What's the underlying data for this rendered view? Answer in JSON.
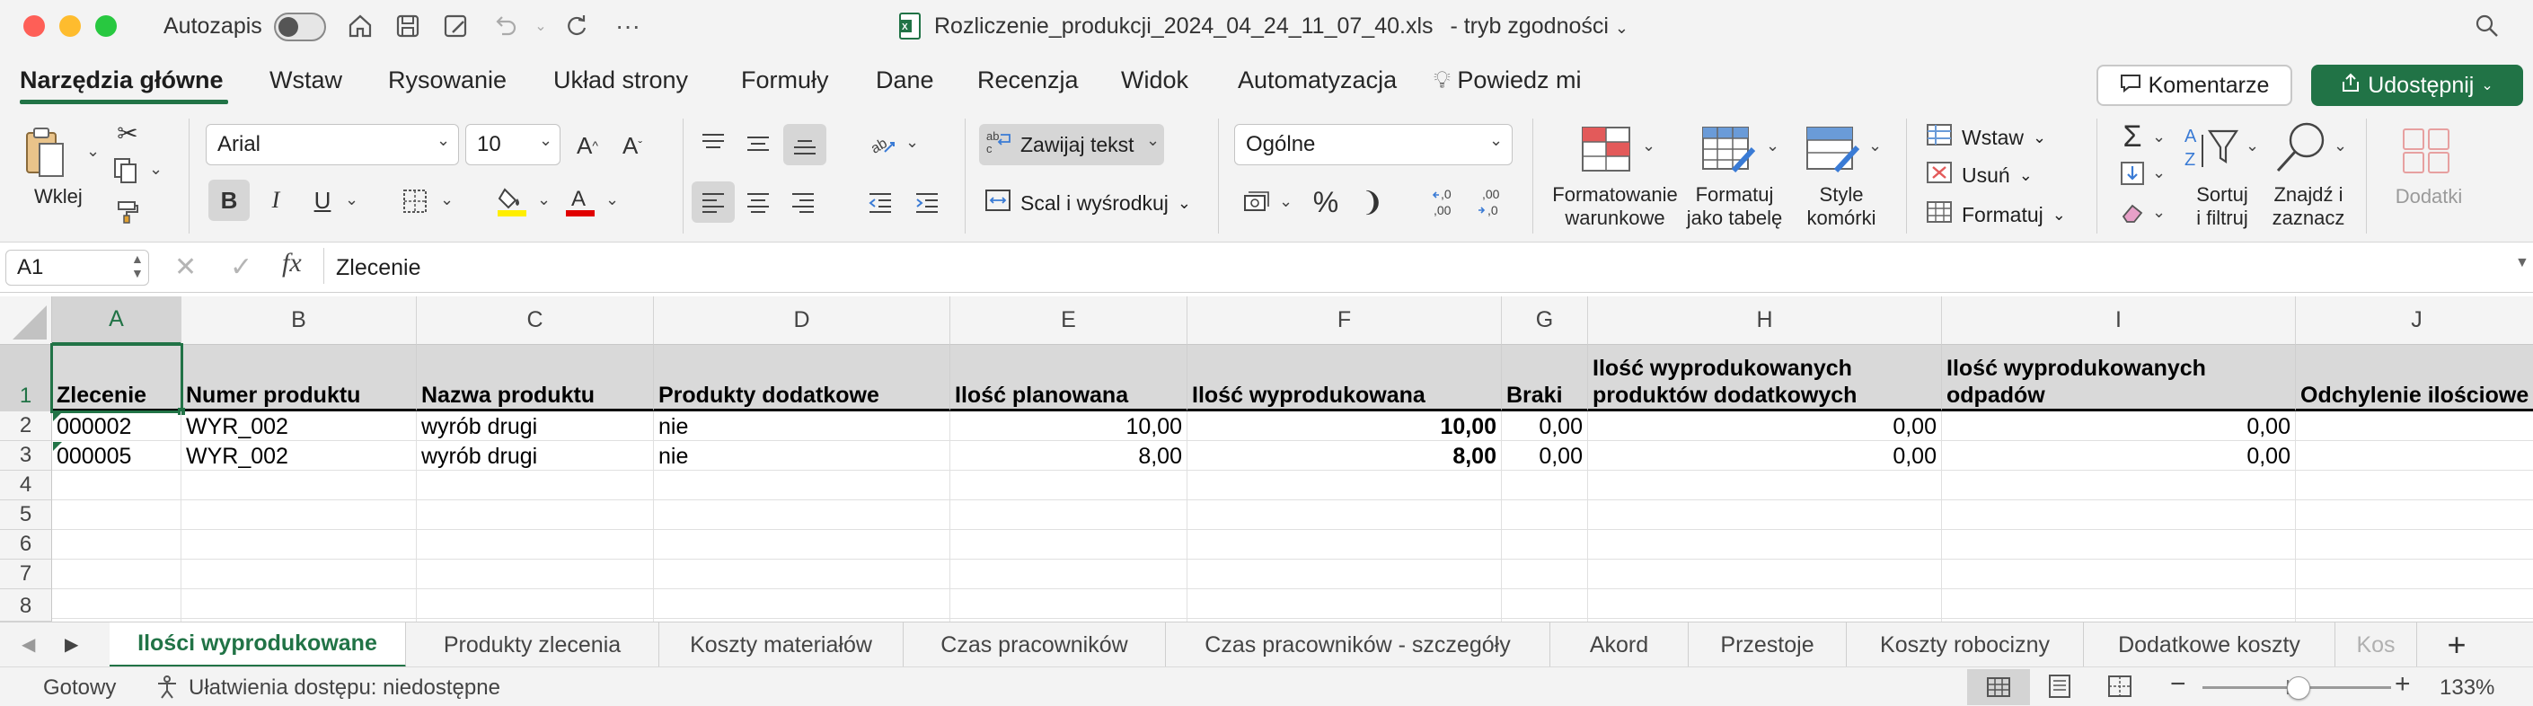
{
  "titlebar": {
    "autosave_label": "Autozapis",
    "filename": "Rozliczenie_produkcji_2024_04_24_11_07_40.xls",
    "mode": "-  tryb zgodności"
  },
  "ribbon_tabs": [
    "Narzędzia główne",
    "Wstaw",
    "Rysowanie",
    "Układ strony",
    "Formuły",
    "Dane",
    "Recenzja",
    "Widok",
    "Automatyzacja"
  ],
  "tell_me": "Powiedz mi",
  "comments_label": "Komentarze",
  "share_label": "Udostępnij",
  "ribbon": {
    "paste_label": "Wklej",
    "font_name": "Arial",
    "font_size": "10",
    "bold_label": "B",
    "italic_label": "I",
    "underline_label": "U",
    "wrap_text": "Zawijaj tekst",
    "merge_center": "Scal i wyśrodkuj",
    "number_format": "Ogólne",
    "percent_label": "%",
    "comma_label": "❩",
    "cond_format": [
      "Formatowanie",
      "warunkowe"
    ],
    "format_table": [
      "Formatuj",
      "jako tabelę"
    ],
    "cell_styles": [
      "Style",
      "komórki"
    ],
    "insert_label": "Wstaw",
    "delete_label": "Usuń",
    "format_label": "Formatuj",
    "sort_filter": [
      "Sortuj",
      "i filtruj"
    ],
    "find_select": [
      "Znajdź i",
      "zaznacz"
    ],
    "addins": "Dodatki"
  },
  "formula_bar": {
    "name_box": "A1",
    "fx": "fx",
    "content": "Zlecenie"
  },
  "columns": [
    "A",
    "B",
    "C",
    "D",
    "E",
    "F",
    "G",
    "H",
    "I",
    "J"
  ],
  "rows": [
    "1",
    "2",
    "3",
    "4",
    "5",
    "6",
    "7",
    "8"
  ],
  "header_row": {
    "A": "Zlecenie",
    "B": "Numer produktu",
    "C": "Nazwa produktu",
    "D": "Produkty dodatkowe",
    "E": "Ilość planowana",
    "F": "Ilość wyprodukowana",
    "G": "Braki",
    "H1": "Ilość wyprodukowanych",
    "H2": "produktów dodatkowych",
    "I1": "Ilość wyprodukowanych",
    "I2": "odpadów",
    "J": "Odchylenie ilościowe"
  },
  "data_rows": [
    {
      "A": "000002",
      "B": "WYR_002",
      "C": "wyrób drugi",
      "D": "nie",
      "E": "10,00",
      "F": "10,00",
      "G": "0,00",
      "H": "0,00",
      "I": "0,00"
    },
    {
      "A": "000005",
      "B": "WYR_002",
      "C": "wyrób drugi",
      "D": "nie",
      "E": "8,00",
      "F": "8,00",
      "G": "0,00",
      "H": "0,00",
      "I": "0,00"
    }
  ],
  "sheet_tabs": [
    "Ilości wyprodukowane",
    "Produkty zlecenia",
    "Koszty materiałów",
    "Czas pracowników",
    "Czas pracowników - szczegóły",
    "Akord",
    "Przestoje",
    "Koszty robocizny",
    "Dodatkowe koszty",
    "Kos"
  ],
  "status": {
    "ready": "Gotowy",
    "accessibility": "Ułatwienia dostępu: niedostępne",
    "zoom": "133%"
  },
  "colors": {
    "accent": "#217346",
    "header_fill": "#d9d9d9"
  }
}
